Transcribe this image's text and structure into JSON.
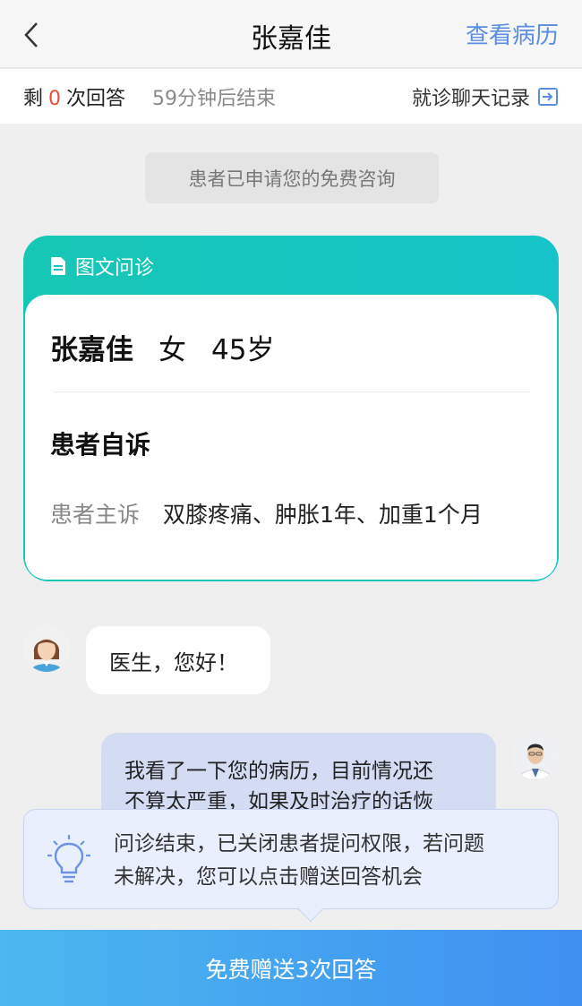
{
  "header": {
    "title": "张嘉佳",
    "records_link": "查看病历"
  },
  "status": {
    "remain_prefix": "剩",
    "remain_count": "0",
    "remain_suffix": "次回答",
    "countdown": "59分钟后结束",
    "chat_log": "就诊聊天记录"
  },
  "system_notice": "患者已申请您的免费咨询",
  "card": {
    "title": "图文问诊",
    "patient_name": "张嘉佳",
    "gender": "女",
    "age": "45岁",
    "section_title": "患者自诉",
    "complaint_label": "患者主诉",
    "complaint_value": "双膝疼痛、肿胀1年、加重1个月"
  },
  "chat": {
    "patient_message": "医生，您好！",
    "doctor_message_line1": "我看了一下您的病历，目前情况还",
    "doctor_message_line2": "不算太严重，如果及时治疗的话恢"
  },
  "tooltip": {
    "line1": "问诊结束，已关闭患者提问权限，若问题",
    "line2": "未解决，您可以点击赠送回答机会"
  },
  "bottom_button": "免费赠送3次回答",
  "colors": {
    "accent_blue": "#5b8ee0",
    "teal": "#17c7b5",
    "count_red": "#e84c3d",
    "button_blue": "#3f8ff0"
  },
  "icons": [
    "back-chevron-icon",
    "document-icon",
    "exit-arrow-icon",
    "lightbulb-icon"
  ]
}
